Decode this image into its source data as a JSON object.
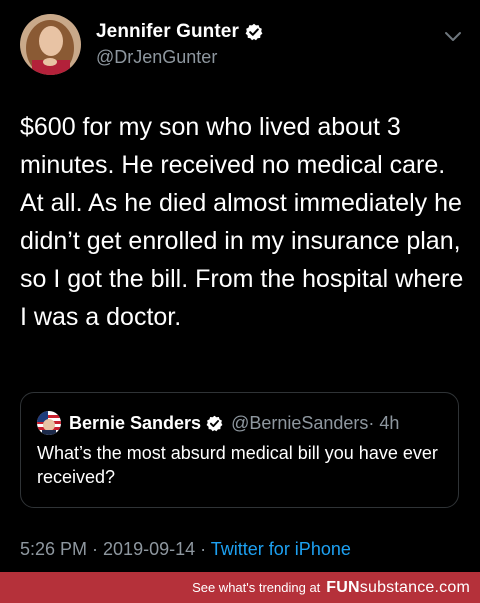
{
  "tweet": {
    "author_name": "Jennifer Gunter",
    "author_handle": "@DrJenGunter",
    "text": "$600 for my son who lived about 3 minutes. He received no medical care. At all. As he died almost immediately he didn’t get enrolled in my insurance plan, so I got the bill.  From the hospital where I was a doctor.",
    "timestamp": "5:26 PM · 2019-09-14 ·",
    "source": "Twitter for iPhone"
  },
  "quote": {
    "author_name": "Bernie Sanders",
    "author_handle": "@BernieSanders",
    "time": "· 4h",
    "text": "What’s the most absurd medical bill you have ever received?"
  },
  "footer": {
    "trending_text": "See what's trending at",
    "logo_bold": "FUN",
    "logo_rest": "substance.com"
  },
  "colors": {
    "background": "#000000",
    "secondary_text": "#8e979f",
    "link": "#1da1f2",
    "verified": "#ffffff",
    "footer_bar": "#b5313a"
  },
  "icons": [
    "verified-icon",
    "chevron-down-icon"
  ]
}
